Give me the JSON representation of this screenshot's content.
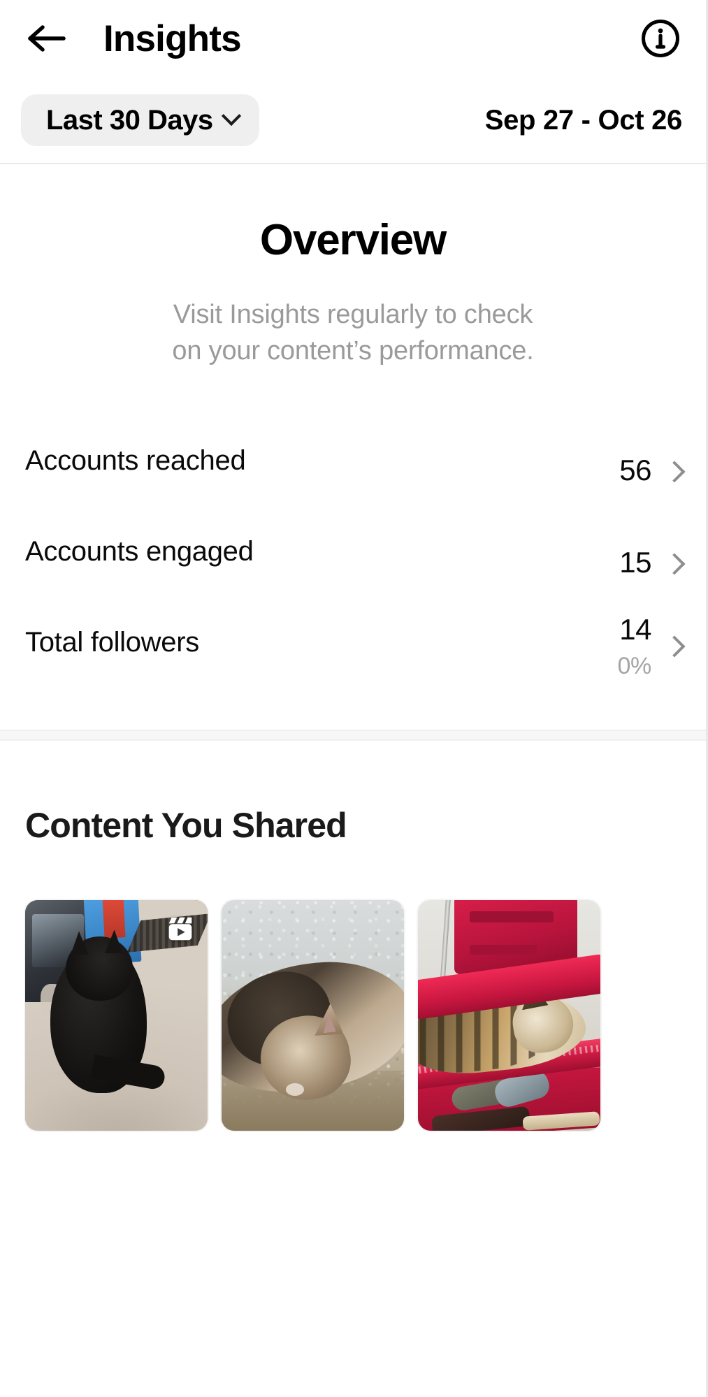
{
  "navbar": {
    "back_icon": "arrow-left-icon",
    "title": "Insights",
    "info_icon": "info-circle-icon"
  },
  "filter": {
    "range_label": "Last 30 Days",
    "chevron_icon": "chevron-down-icon",
    "date_range": "Sep 27 - Oct 26"
  },
  "overview": {
    "title": "Overview",
    "subtitle_line1": "Visit Insights regularly to check",
    "subtitle_line2": "on your content’s performance.",
    "metrics": [
      {
        "label": "Accounts reached",
        "value": "56",
        "delta": "",
        "chevron_icon": "chevron-right-icon"
      },
      {
        "label": "Accounts engaged",
        "value": "15",
        "delta": "",
        "chevron_icon": "chevron-right-icon"
      },
      {
        "label": "Total followers",
        "value": "14",
        "delta": "0%",
        "chevron_icon": "chevron-right-icon"
      }
    ]
  },
  "content_shared": {
    "title": "Content You Shared",
    "thumbnails": [
      {
        "alt": "black cat sitting on carpet",
        "is_reel": true,
        "reel_icon": "reel-clapperboard-icon"
      },
      {
        "alt": "tabby cat lying on light carpet",
        "is_reel": false,
        "reel_icon": ""
      },
      {
        "alt": "tabby cat resting in red suitcase",
        "is_reel": false,
        "reel_icon": ""
      }
    ]
  },
  "colors": {
    "background": "#ffffff",
    "text_primary": "#000000",
    "text_muted": "#9a9a9a",
    "pill_background": "#efefef",
    "chevron": "#8e8e8e",
    "divider": "#eaeaea",
    "section_gap": "#f7f7f7"
  }
}
